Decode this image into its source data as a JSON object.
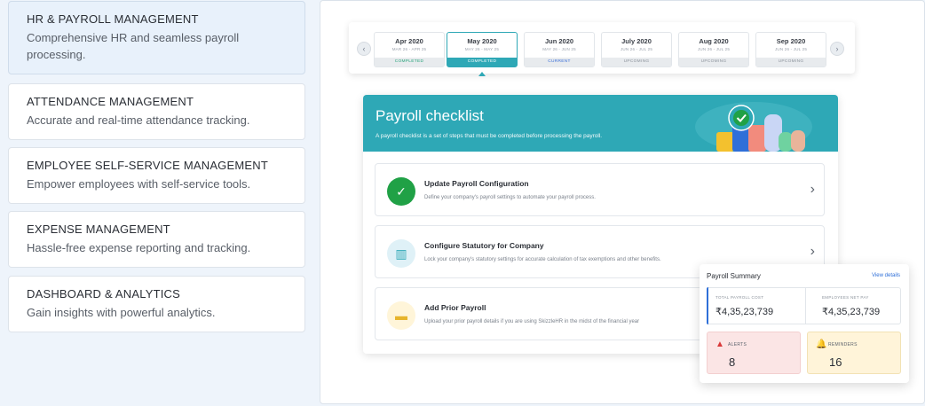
{
  "features": [
    {
      "title": "HR & PAYROLL MANAGEMENT",
      "desc": "Comprehensive HR and seamless payroll processing."
    },
    {
      "title": "ATTENDANCE MANAGEMENT",
      "desc": "Accurate and real-time attendance tracking."
    },
    {
      "title": "EMPLOYEE SELF-SERVICE MANAGEMENT",
      "desc": "Empower employees with self-service tools."
    },
    {
      "title": "EXPENSE MANAGEMENT",
      "desc": "Hassle-free expense reporting and tracking."
    },
    {
      "title": "DASHBOARD & ANALYTICS",
      "desc": "Gain insights with powerful analytics."
    }
  ],
  "months": [
    {
      "name": "Apr 2020",
      "range": "MAR 26 - APR 25",
      "status": "COMPLETED"
    },
    {
      "name": "May 2020",
      "range": "MAY 26 - MAY 25",
      "status": "COMPLETED"
    },
    {
      "name": "Jun 2020",
      "range": "MAY 26 - JUN 25",
      "status": "CURRENT"
    },
    {
      "name": "July 2020",
      "range": "JUN 26 - JUL 25",
      "status": "UPCOMING"
    },
    {
      "name": "Aug 2020",
      "range": "JUN 26 - JUL 25",
      "status": "UPCOMING"
    },
    {
      "name": "Sep 2020",
      "range": "JUN 26 - JUL 25",
      "status": "UPCOMING"
    }
  ],
  "nav": {
    "prev": "‹",
    "next": "›"
  },
  "checklist": {
    "title": "Payroll checklist",
    "subtitle": "A payroll checklist is a set of steps that must be completed before processing the payroll.",
    "items": [
      {
        "title": "Update Payroll Configuration",
        "desc": "Define your company's payroll settings to automate your payroll process.",
        "icon": "check-icon",
        "glyph": "✓",
        "chevron": "›"
      },
      {
        "title": "Configure Statutory for Company",
        "desc": "Lock your company's statutory settings for accurate calculation of tax exemptions and other benefits.",
        "icon": "building-icon",
        "glyph": "▥",
        "chevron": "›"
      },
      {
        "title": "Add Prior Payroll",
        "desc": "Upload your prior payroll details if you are using SkizzleHR in the midst of the financial year",
        "icon": "wallet-icon",
        "glyph": "▬",
        "chevron": "›"
      }
    ]
  },
  "summary": {
    "title": "Payroll Summary",
    "link": "View details",
    "total_label": "TOTAL PAYROLL COST",
    "total_value": "₹4,35,23,739",
    "net_label": "EMPLOYEES NET PAY",
    "net_value": "₹4,35,23,739",
    "alerts_label": "ALERTS",
    "alerts_value": "8",
    "alerts_icon": "▲",
    "reminders_label": "REMINDERS",
    "reminders_value": "16",
    "reminders_icon": "🔔"
  },
  "colors": {
    "teal": "#2ea8b6",
    "green": "#20a146",
    "blue": "#2e6fd8",
    "alert": "#d93a3a",
    "reminder": "#e7b42c"
  }
}
